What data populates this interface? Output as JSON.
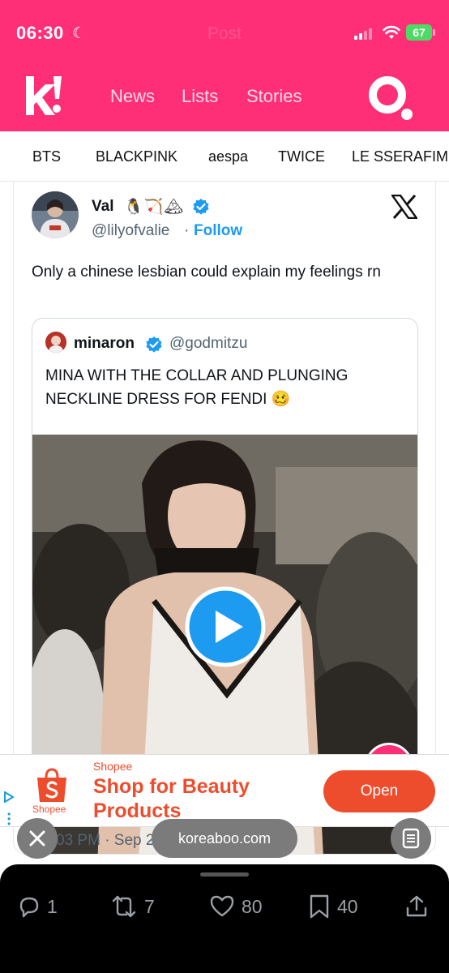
{
  "status_bar": {
    "time": "06:30",
    "ghost_title": "Post",
    "battery": "67"
  },
  "header": {
    "nav": [
      "News",
      "Lists",
      "Stories"
    ]
  },
  "categories": [
    "BTS",
    "BLACKPINK",
    "aespa",
    "TWICE",
    "LE SSERAFIM"
  ],
  "tweet": {
    "author_name": "Val",
    "author_emoji": "🐧🏹🏔",
    "handle": "@lilyofvalie",
    "separator": "·",
    "follow_label": "Follow",
    "text": "Only a chinese lesbian could explain my feelings rn",
    "time_partial": "03 PM · Sep 2",
    "quote": {
      "name": "minaron",
      "handle": "@godmitzu",
      "text": "MINA WITH THE COLLAR AND PLUNGING NECKLINE DRESS FOR FENDI 🥴"
    }
  },
  "ad": {
    "brand": "Shopee",
    "logo_label": "Shopee",
    "title": "Shop for Beauty Products",
    "button": "Open"
  },
  "browser": {
    "url": "koreaboo.com"
  },
  "actions": {
    "replies": "1",
    "retweets": "7",
    "likes": "80",
    "bookmarks": "40"
  },
  "colors": {
    "brand_pink": "#fe2f77",
    "twitter_blue": "#1d9bf0",
    "shopee_orange": "#ee4d2d"
  }
}
